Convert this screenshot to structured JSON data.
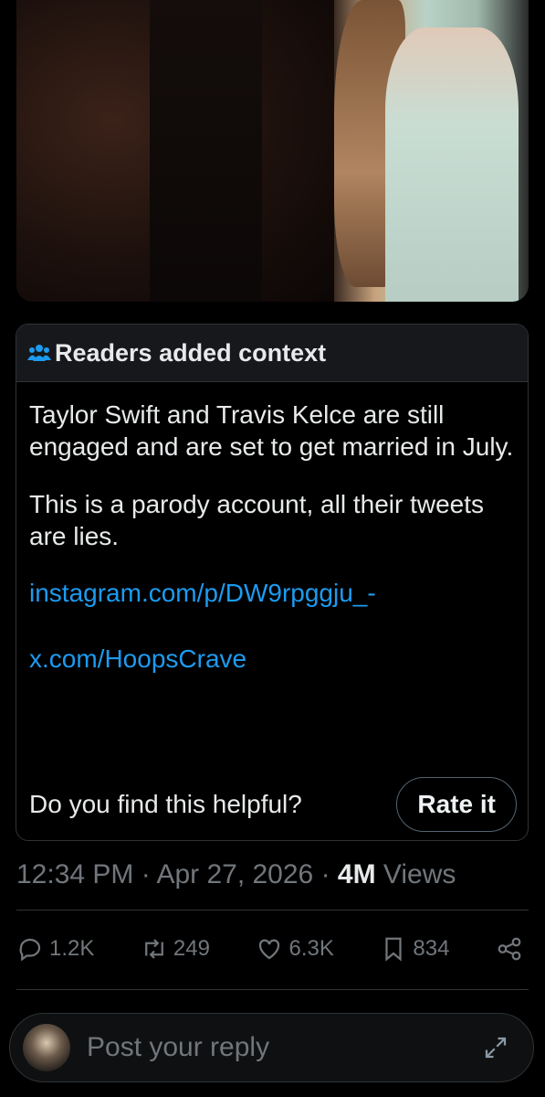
{
  "note": {
    "title": "Readers added context",
    "paragraph1": "Taylor Swift and Travis Kelce are still engaged and are set to get married in July.",
    "paragraph2": "This is a parody account, all their tweets are lies.",
    "link1": "instagram.com/p/DW9rpggju_-",
    "link2": "x.com/HoopsCrave",
    "question": "Do you find this helpful?",
    "rate_label": "Rate it"
  },
  "meta": {
    "time": "12:34 PM",
    "sep1": " · ",
    "date": "Apr 27, 2026",
    "sep2": " · ",
    "views_count": "4M",
    "views_label": " Views"
  },
  "actions": {
    "replies": "1.2K",
    "reposts": "249",
    "likes": "6.3K",
    "bookmarks": "834"
  },
  "reply": {
    "placeholder": "Post your reply"
  },
  "icons": [
    "people-icon",
    "reply-icon",
    "repost-icon",
    "like-icon",
    "bookmark-icon",
    "share-icon",
    "expand-icon"
  ],
  "colors": {
    "link": "#1d9bf0",
    "muted": "#71767b",
    "text": "#e7e9ea"
  }
}
